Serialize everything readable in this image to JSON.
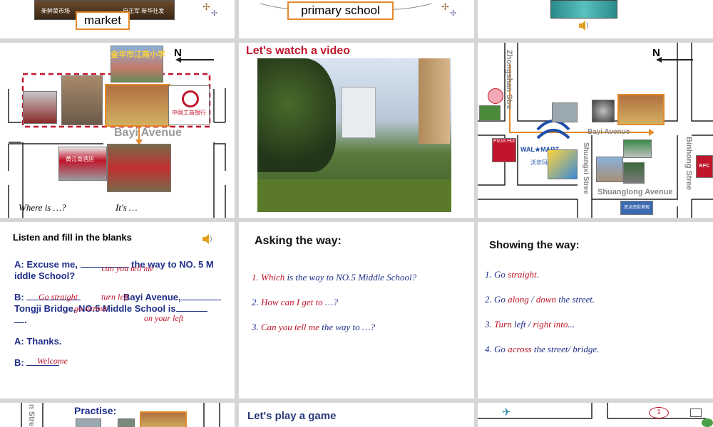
{
  "row0": {
    "market_label": "market",
    "market_sign_left": "新鲜菜市场",
    "market_sign_right": "自正军 新华社发",
    "school_label": "primary school"
  },
  "map1": {
    "north": "N",
    "avenue": "Bayi Avenue",
    "where_is": "Where is …?",
    "its": "It's …",
    "bank_sign": "中国工商银行",
    "school_sign": "金华市江南小学",
    "hotel_sign": "黄江南酒店"
  },
  "video": {
    "title": "Let's watch a video"
  },
  "map2": {
    "north": "N",
    "zhongshan": "Zhongshan Stre",
    "bayi": "Bayi Avenue",
    "shuangxi": "Shuangxi Stree",
    "binhong": "Binhong Stree",
    "shuanglong": "Shuanglong Avenue",
    "walmart": "WAL★MART",
    "walmart_cn": "沃尔玛",
    "kfc": "KFC",
    "pizza": "Pizza Hut",
    "bottom_sign": "双龙南街景观"
  },
  "listen": {
    "title": "Listen and fill in the blanks",
    "a1_prefix": "A: Excuse me, ",
    "a1_answer": "can you tell me",
    "a1_suffix": " the way to NO. 5 M iddle School?",
    "b_prefix": "B: ",
    "b_answer1": "Go straight",
    "b_answer2": "turn left",
    "b_mid": " Bayi Avenue,",
    "b_line2": "Tongji Bridge, NO.5 Middle School is",
    "b_answer3": "go across",
    "b_answer4": "on your left",
    "b_end": ".",
    "a2": "A: Thanks.",
    "b2_prefix": "B: ",
    "b2_answer": "Welcome"
  },
  "asking": {
    "title": "Asking the way:",
    "items": [
      {
        "num": "1.",
        "red": "Which",
        "rest": " is the way to NO.5 Middle School?"
      },
      {
        "num": "2.",
        "red": "How can I get to",
        "rest": " …?"
      },
      {
        "num": "3.",
        "red": "Can you tell me",
        "rest": " the way to …?"
      }
    ]
  },
  "showing": {
    "title": "Showing the way:",
    "items": [
      {
        "parts": [
          "1. Go ",
          "straight",
          "."
        ]
      },
      {
        "parts": [
          "2. Go ",
          "along",
          " / ",
          "down",
          " the street."
        ]
      },
      {
        "parts": [
          "3. ",
          "Turn",
          " left / ",
          "right",
          " into",
          "..."
        ]
      },
      {
        "parts": [
          "4. Go ",
          "across",
          " the street/ bridge."
        ]
      }
    ]
  },
  "row3": {
    "practise": "Practise:",
    "street_frag": "n Stre",
    "game_title": "Let's play a game",
    "badge": "1"
  },
  "colors": {
    "red": "#c0152b",
    "navy": "#1f2e8a",
    "orange": "#e38a2c",
    "blue": "#1f4fa8"
  }
}
